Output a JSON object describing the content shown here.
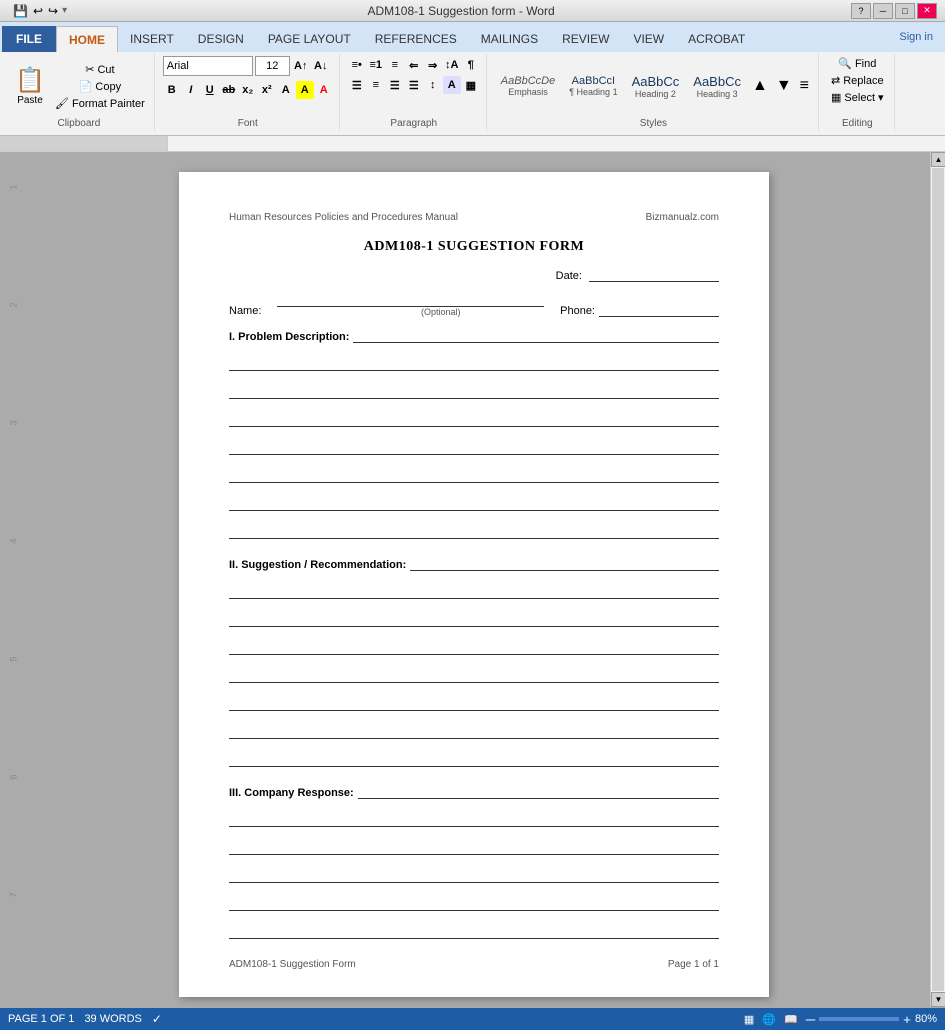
{
  "titleBar": {
    "title": "ADM108-1 Suggestion form - Word",
    "helpBtn": "?",
    "minimizeBtn": "─",
    "maximizeBtn": "□",
    "closeBtn": "✕"
  },
  "quickAccess": {
    "save": "💾",
    "undo": "↩",
    "redo": "↪"
  },
  "ribbonTabs": [
    "FILE",
    "HOME",
    "INSERT",
    "DESIGN",
    "PAGE LAYOUT",
    "REFERENCES",
    "MAILINGS",
    "REVIEW",
    "VIEW",
    "ACROBAT"
  ],
  "activeTab": "HOME",
  "signIn": "Sign in",
  "groups": {
    "clipboard": {
      "label": "Clipboard",
      "paste": "Paste"
    },
    "font": {
      "label": "Font",
      "name": "Arial",
      "size": "12",
      "bold": "B",
      "italic": "I",
      "underline": "U"
    },
    "paragraph": {
      "label": "Paragraph"
    },
    "styles": {
      "label": "Styles",
      "items": [
        {
          "name": "Emphasis",
          "preview": "AaBbCcDe"
        },
        {
          "name": "Heading 1",
          "preview": "AaBbCcI"
        },
        {
          "name": "Heading 2",
          "preview": "AaBbCc"
        },
        {
          "name": "Heading 3",
          "preview": "AaBbCc"
        }
      ]
    },
    "editing": {
      "label": "Editing",
      "find": "Find",
      "replace": "Replace",
      "select": "Select ▾"
    }
  },
  "document": {
    "headerLeft": "Human Resources Policies and Procedures Manual",
    "headerRight": "Bizmanualz.com",
    "formTitle": "ADM108-1 SUGGESTION FORM",
    "dateLabel": "Date:",
    "nameLabel": "Name:",
    "optionalText": "(Optional)",
    "phoneLabel": "Phone:",
    "sections": [
      {
        "label": "I. Problem Description:",
        "lines": 8
      },
      {
        "label": "II. Suggestion / Recommendation:",
        "lines": 8
      },
      {
        "label": "III. Company Response:",
        "lines": 6
      }
    ],
    "footerLeft": "ADM108-1 Suggestion Form",
    "footerRight": "Page 1 of 1"
  },
  "statusBar": {
    "page": "PAGE 1 OF 1",
    "words": "39 WORDS",
    "zoom": "80%"
  }
}
